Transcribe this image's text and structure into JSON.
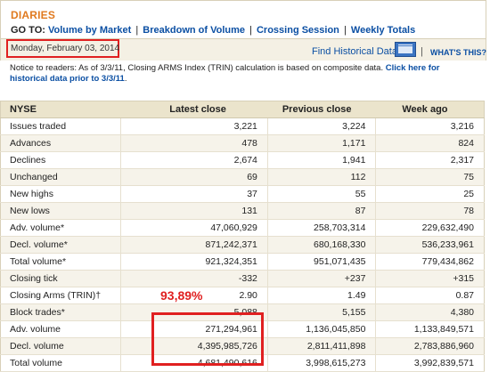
{
  "header": {
    "section_title": "DIARIES",
    "goto_label": "GO TO:",
    "links": [
      "Volume by Market",
      "Breakdown of Volume",
      "Crossing Session",
      "Weekly Totals"
    ]
  },
  "date_bar": {
    "date": "Monday, February 03, 2014",
    "historical_link": "Find Historical Data",
    "whats_this": "WHAT'S THIS?",
    "separator": "|"
  },
  "notice": {
    "text": "Notice to readers: As of 3/3/11, Closing ARMS Index (TRIN) calculation is based on composite data. ",
    "link": "Click here for historical data prior to 3/3/11",
    "suffix": "."
  },
  "table": {
    "headers": [
      "NYSE",
      "Latest close",
      "Previous close",
      "Week ago"
    ],
    "rows": [
      [
        "Issues traded",
        "3,221",
        "3,224",
        "3,216"
      ],
      [
        "Advances",
        "478",
        "1,171",
        "824"
      ],
      [
        "Declines",
        "2,674",
        "1,941",
        "2,317"
      ],
      [
        "Unchanged",
        "69",
        "112",
        "75"
      ],
      [
        "New highs",
        "37",
        "55",
        "25"
      ],
      [
        "New lows",
        "131",
        "87",
        "78"
      ],
      [
        "Adv. volume*",
        "47,060,929",
        "258,703,314",
        "229,632,490"
      ],
      [
        "Decl. volume*",
        "871,242,371",
        "680,168,330",
        "536,233,961"
      ],
      [
        "Total volume*",
        "921,324,351",
        "951,071,435",
        "779,434,862"
      ],
      [
        "Closing tick",
        "-332",
        "+237",
        "+315"
      ],
      [
        "Closing Arms (TRIN)†",
        "2.90",
        "1.49",
        "0.87"
      ],
      [
        "Block trades*",
        "5,088",
        "5,155",
        "4,380"
      ],
      [
        "Adv. volume",
        "271,294,961",
        "1,136,045,850",
        "1,133,849,571"
      ],
      [
        "Decl. volume",
        "4,395,985,726",
        "2,811,411,898",
        "2,783,886,960"
      ],
      [
        "Total volume",
        "4,681,490,616",
        "3,998,615,273",
        "3,992,839,571"
      ]
    ]
  },
  "annotation": {
    "percent": "93,89%",
    "color": "#e02020"
  },
  "colors": {
    "accent_orange": "#e07a1f",
    "link_blue": "#0b4fa3",
    "header_bg": "#ebe4cc"
  },
  "icons": {
    "calendar": "calendar-icon"
  }
}
